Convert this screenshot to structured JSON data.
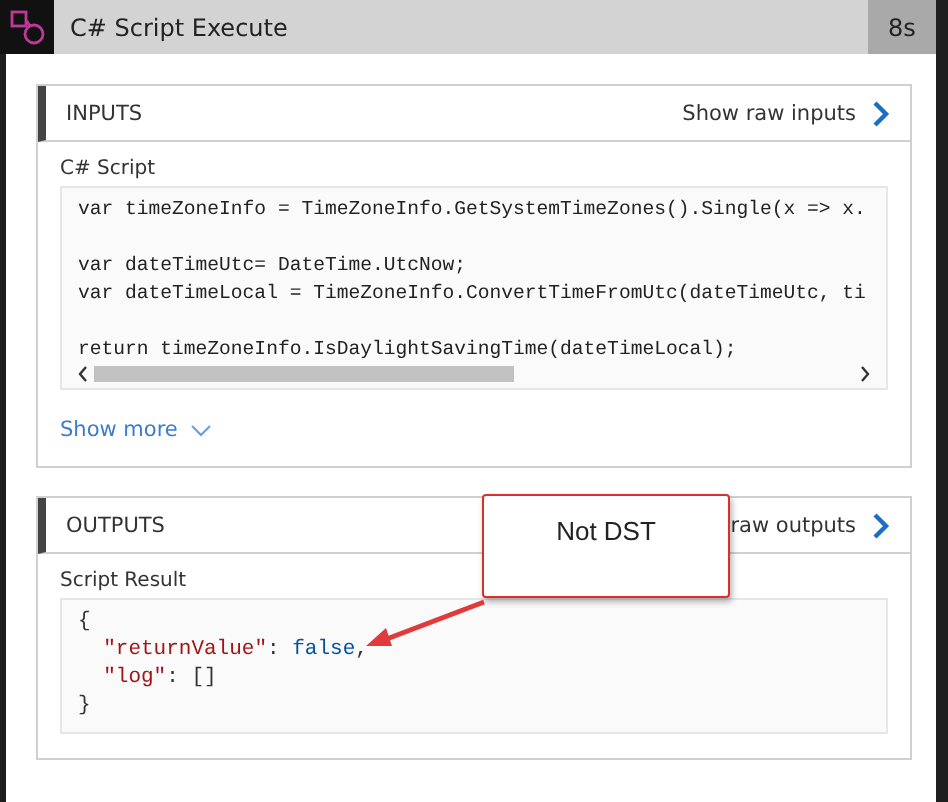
{
  "header": {
    "title": "C# Script Execute",
    "duration": "8s"
  },
  "inputs": {
    "title": "INPUTS",
    "raw_link": "Show raw inputs",
    "field_label": "C# Script",
    "code_paragraphs": [
      [
        "var timeZoneInfo = TimeZoneInfo.GetSystemTimeZones().Single(x => x."
      ],
      [
        "var dateTimeUtc= DateTime.UtcNow;",
        "var dateTimeLocal = TimeZoneInfo.ConvertTimeFromUtc(dateTimeUtc, ti"
      ],
      [
        "return timeZoneInfo.IsDaylightSavingTime(dateTimeLocal);"
      ]
    ],
    "show_more": "Show more"
  },
  "outputs": {
    "title": "OUTPUTS",
    "raw_link": "raw outputs",
    "field_label": "Script Result",
    "result_lines": [
      [
        {
          "kind": "punct",
          "text": "{"
        }
      ],
      [
        {
          "kind": "key",
          "text": "  \"returnValue\""
        },
        {
          "kind": "punct",
          "text": ": "
        },
        {
          "kind": "value",
          "text": "false"
        },
        {
          "kind": "punct",
          "text": ","
        }
      ],
      [
        {
          "kind": "key",
          "text": "  \"log\""
        },
        {
          "kind": "punct",
          "text": ": []"
        }
      ],
      [
        {
          "kind": "punct",
          "text": "}"
        }
      ]
    ]
  },
  "callout": {
    "text": "Not DST"
  }
}
